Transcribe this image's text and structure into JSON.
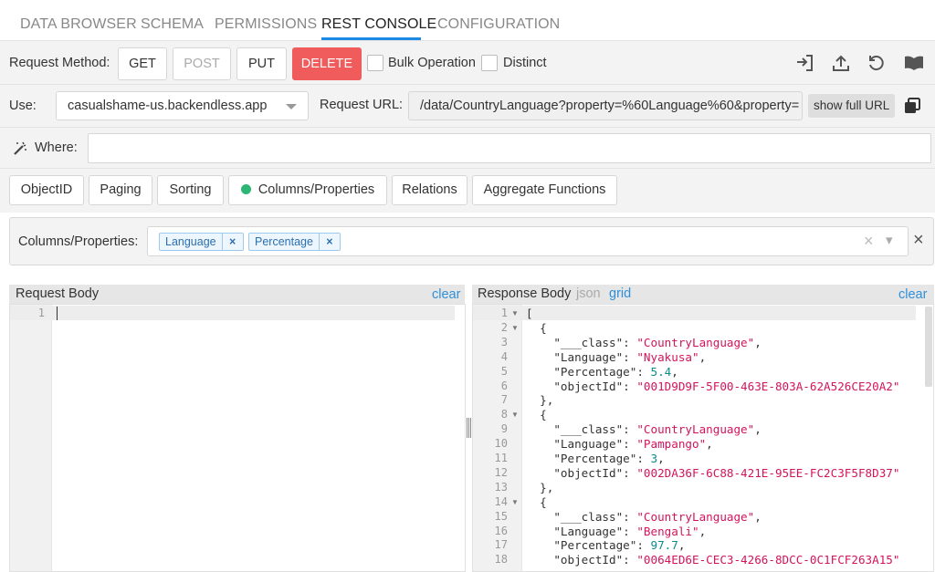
{
  "tabs": [
    {
      "label": "DATA BROWSER"
    },
    {
      "label": "SCHEMA"
    },
    {
      "label": "PERMISSIONS"
    },
    {
      "label": "REST CONSOLE"
    },
    {
      "label": "CONFIGURATION"
    }
  ],
  "active_tab": "REST CONSOLE",
  "method": {
    "label": "Request Method:",
    "get": "GET",
    "post": "POST",
    "put": "PUT",
    "delete": "DELETE",
    "bulk": "Bulk Operation",
    "distinct": "Distinct"
  },
  "toolbar_icons": [
    "sign-in-icon",
    "upload-icon",
    "undo-icon",
    "book-icon"
  ],
  "use": {
    "label": "Use:",
    "value": "casualshame-us.backendless.app"
  },
  "request_url": {
    "label": "Request URL:",
    "value": "/data/CountryLanguage?property=%60Language%60&property=",
    "show_full": "show full URL"
  },
  "where": {
    "label": "Where:",
    "value": ""
  },
  "subtabs": {
    "objectid": "ObjectID",
    "paging": "Paging",
    "sorting": "Sorting",
    "columns": "Columns/Properties",
    "relations": "Relations",
    "aggregate": "Aggregate Functions"
  },
  "columns_panel": {
    "label": "Columns/Properties:",
    "chips": [
      "Language",
      "Percentage"
    ],
    "chip_remove": "×",
    "clear_all": "×",
    "dropdown": "▾",
    "close": "×"
  },
  "request_body": {
    "title": "Request Body",
    "clear": "clear",
    "line_number": "1"
  },
  "response_body": {
    "title": "Response Body",
    "json": "json",
    "grid": "grid",
    "clear": "clear"
  },
  "response_lines": [
    {
      "n": "1",
      "fold": true,
      "text": "["
    },
    {
      "n": "2",
      "fold": true,
      "text": "  {"
    },
    {
      "n": "3",
      "fold": false,
      "key": "    \"___class\": ",
      "val": "\"CountryLanguage\"",
      "vtype": "str",
      "tail": ","
    },
    {
      "n": "4",
      "fold": false,
      "key": "    \"Language\": ",
      "val": "\"Nyakusa\"",
      "vtype": "str",
      "tail": ","
    },
    {
      "n": "5",
      "fold": false,
      "key": "    \"Percentage\": ",
      "val": "5.4",
      "vtype": "num",
      "tail": ","
    },
    {
      "n": "6",
      "fold": false,
      "key": "    \"objectId\": ",
      "val": "\"001D9D9F-5F00-463E-803A-62A526CE20A2\"",
      "vtype": "str",
      "tail": ""
    },
    {
      "n": "7",
      "fold": false,
      "text": "  },"
    },
    {
      "n": "8",
      "fold": true,
      "text": "  {"
    },
    {
      "n": "9",
      "fold": false,
      "key": "    \"___class\": ",
      "val": "\"CountryLanguage\"",
      "vtype": "str",
      "tail": ","
    },
    {
      "n": "10",
      "fold": false,
      "key": "    \"Language\": ",
      "val": "\"Pampango\"",
      "vtype": "str",
      "tail": ","
    },
    {
      "n": "11",
      "fold": false,
      "key": "    \"Percentage\": ",
      "val": "3",
      "vtype": "num",
      "tail": ","
    },
    {
      "n": "12",
      "fold": false,
      "key": "    \"objectId\": ",
      "val": "\"002DA36F-6C88-421E-95EE-FC2C3F5F8D37\"",
      "vtype": "str",
      "tail": ""
    },
    {
      "n": "13",
      "fold": false,
      "text": "  },"
    },
    {
      "n": "14",
      "fold": true,
      "text": "  {"
    },
    {
      "n": "15",
      "fold": false,
      "key": "    \"___class\": ",
      "val": "\"CountryLanguage\"",
      "vtype": "str",
      "tail": ","
    },
    {
      "n": "16",
      "fold": false,
      "key": "    \"Language\": ",
      "val": "\"Bengali\"",
      "vtype": "str",
      "tail": ","
    },
    {
      "n": "17",
      "fold": false,
      "key": "    \"Percentage\": ",
      "val": "97.7",
      "vtype": "num",
      "tail": ","
    },
    {
      "n": "18",
      "fold": false,
      "key": "    \"objectId\": ",
      "val": "\"0064ED6E-CEC3-4266-8DCC-0C1FCF263A15\"",
      "vtype": "str",
      "tail": ""
    }
  ],
  "colors": {
    "accent": "#1e88e5",
    "delete": "#f05b5b",
    "link": "#2f8fd8",
    "string": "#d4145a",
    "number": "#0a8c8c",
    "active_indicator": "#2bb673"
  }
}
